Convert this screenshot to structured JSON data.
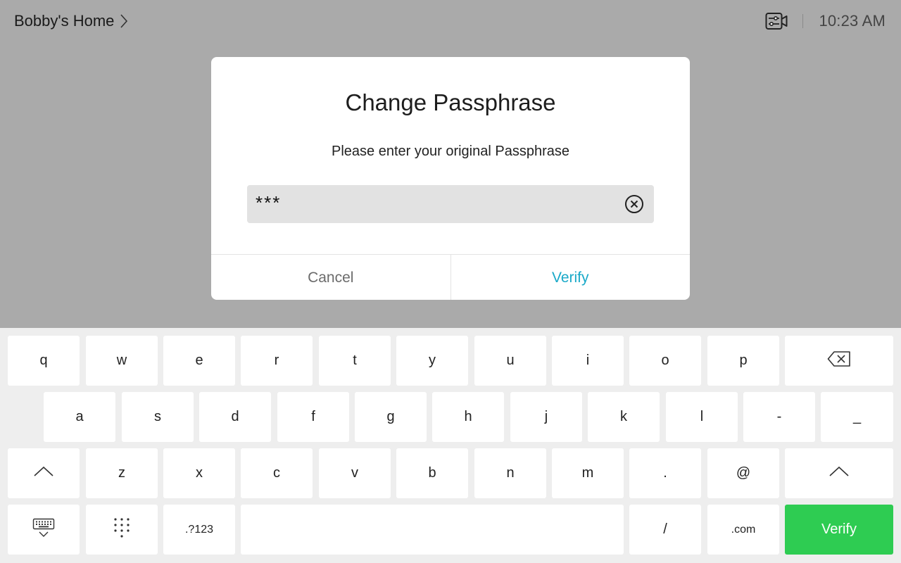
{
  "header": {
    "location": "Bobby's Home",
    "time": "10:23 AM"
  },
  "dialog": {
    "title": "Change Passphrase",
    "message": "Please enter your original Passphrase",
    "field_value": "***",
    "cancel_label": "Cancel",
    "verify_label": "Verify"
  },
  "keyboard": {
    "row1": [
      "q",
      "w",
      "e",
      "r",
      "t",
      "y",
      "u",
      "i",
      "o",
      "p"
    ],
    "row2": [
      "a",
      "s",
      "d",
      "f",
      "g",
      "h",
      "j",
      "k",
      "l",
      "-",
      "_"
    ],
    "row3": [
      "z",
      "x",
      "c",
      "v",
      "b",
      "n",
      "m",
      ".",
      "@"
    ],
    "symbols_label": ".?123",
    "slash_label": "/",
    "dotcom_label": ".com",
    "enter_label": "Verify",
    "enter_color": "#2ecc52"
  },
  "colors": {
    "accent": "#19a9c8",
    "backdrop": "#aaaaaa"
  }
}
